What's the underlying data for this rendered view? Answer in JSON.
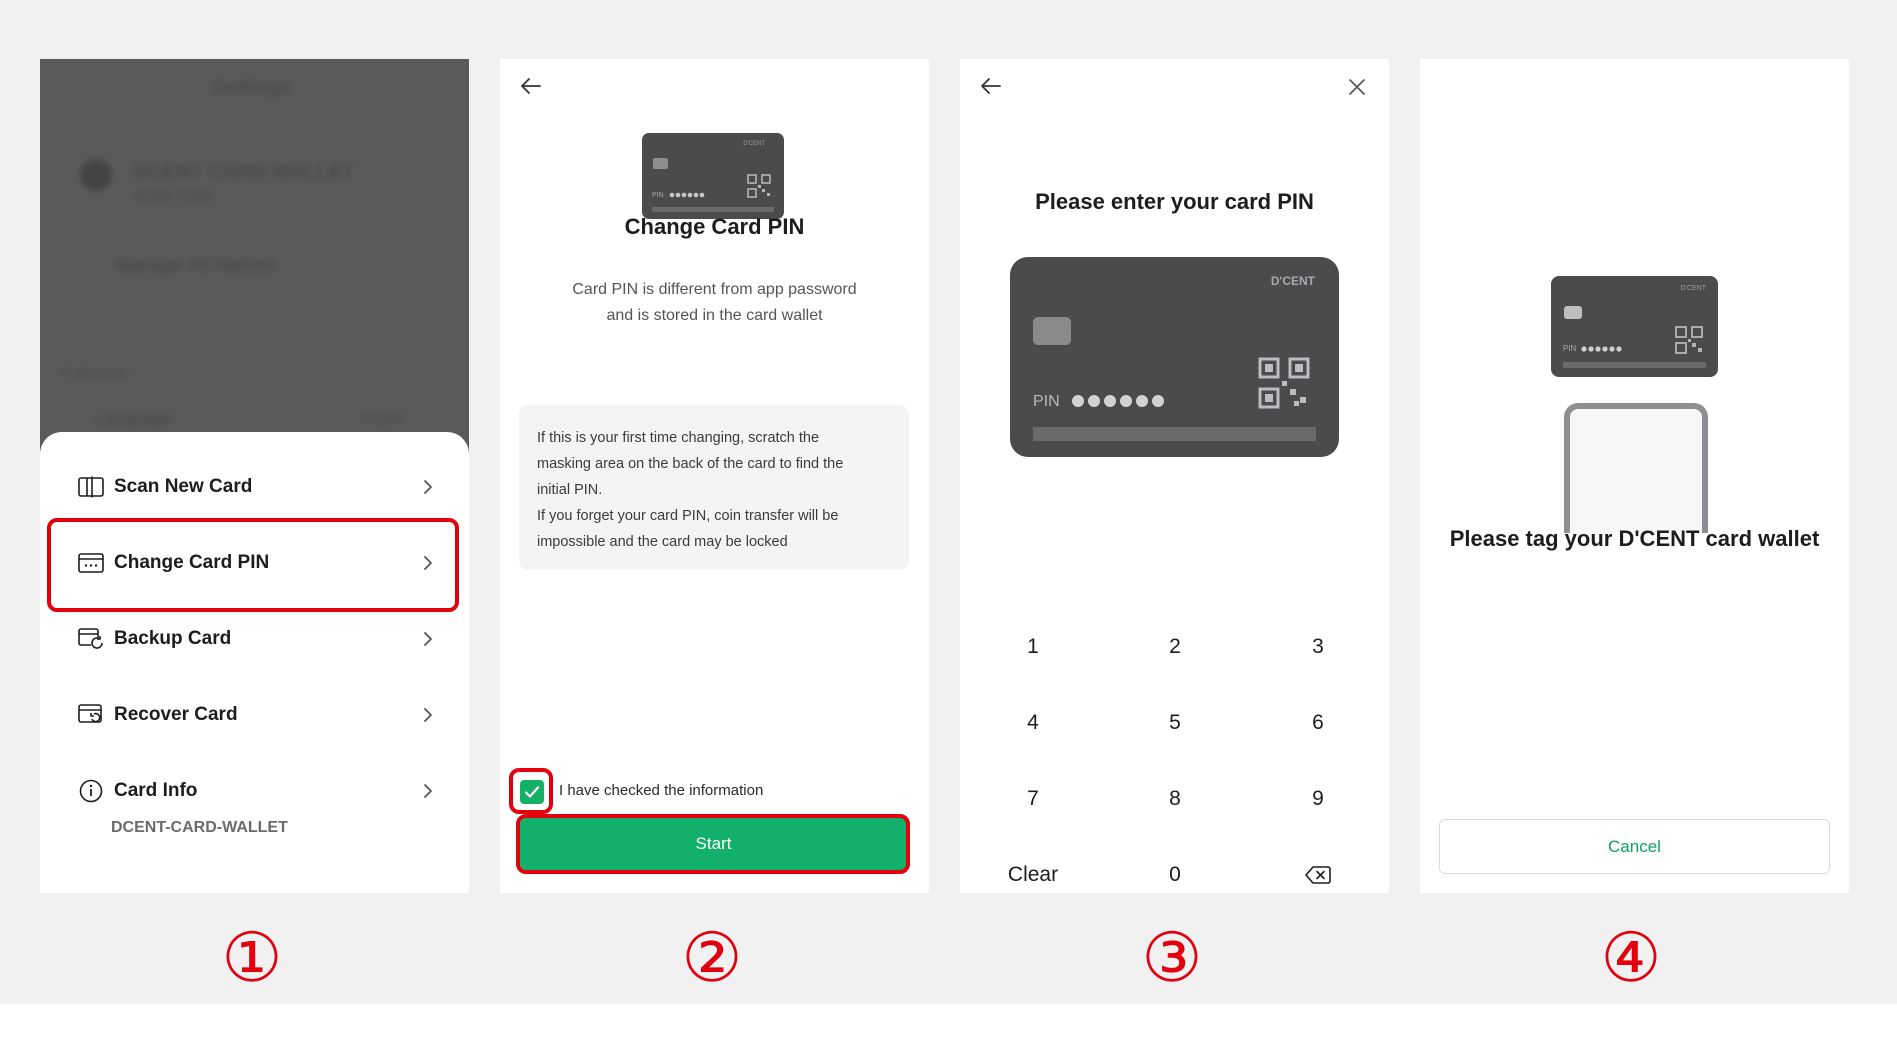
{
  "panel1": {
    "bg_title": "Settings",
    "bg_wallet_name": "DCENT CARD WALLET",
    "bg_wallet_sub": "DCENT CARD",
    "bg_manage": "Manage All Wallets",
    "bg_section": "Preferences",
    "bg_language": "Language",
    "bg_language_value": "English",
    "menu": [
      {
        "label": "Scan New Card",
        "icon": "scan-card-icon"
      },
      {
        "label": "Change Card PIN",
        "icon": "pin-card-icon"
      },
      {
        "label": "Backup Card",
        "icon": "backup-card-icon"
      },
      {
        "label": "Recover Card",
        "icon": "recover-card-icon"
      },
      {
        "label": "Card Info",
        "icon": "info-icon"
      }
    ],
    "card_info_sub": "DCENT-CARD-WALLET",
    "step": "①"
  },
  "panel2": {
    "title": "Change Card PIN",
    "desc_line1": "Card PIN is different from app password",
    "desc_line2": "and is stored in the card wallet",
    "info_lines": [
      "If this is your first time changing, scratch the",
      "masking area on the back of the card to find the",
      "initial PIN.",
      "If you forget your card PIN, coin transfer will be",
      "impossible and the card may be locked"
    ],
    "checkbox_label": "I have checked the information",
    "start_label": "Start",
    "card_pin_label": "PIN",
    "card_brand": "D'CENT",
    "step": "②"
  },
  "panel3": {
    "title": "Please enter your card PIN",
    "card_brand": "D'CENT",
    "card_pin_label": "PIN",
    "keys": [
      "1",
      "2",
      "3",
      "4",
      "5",
      "6",
      "7",
      "8",
      "9",
      "Clear",
      "0",
      "backspace"
    ],
    "step": "③"
  },
  "panel4": {
    "title": "Please tag your D'CENT card wallet",
    "cancel_label": "Cancel",
    "card_brand": "D'CENT",
    "card_pin_label": "PIN",
    "step": "④"
  },
  "colors": {
    "accent_green": "#12b06a",
    "highlight_red": "#e3000e",
    "card_dark": "#4b4b4e"
  }
}
